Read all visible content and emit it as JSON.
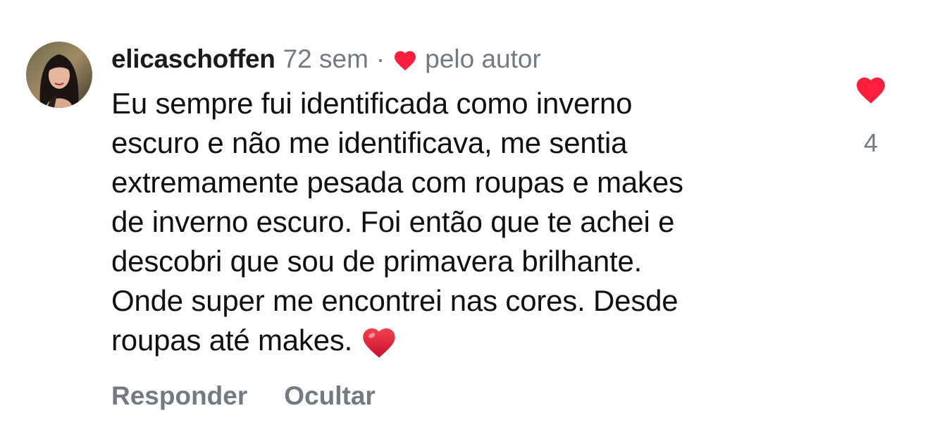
{
  "comment": {
    "username": "elicaschoffen",
    "time_ago": "72 sem",
    "separator": "·",
    "liked_by_author_label": "pelo autor",
    "text": "Eu sempre fui identificada como inverno\nescuro e não me identificava, me sentia\nextremamente pesada com roupas e makes\nde inverno escuro. Foi então que te achei e\ndescobri que sou de primavera brilhante.\nOnde super me encontrei nas cores. Desde\nroupas até makes.",
    "trailing_emoji": "red-heart-emoji",
    "like_count": "4",
    "liked": true
  },
  "actions": {
    "reply_label": "Responder",
    "hide_label": "Ocultar"
  },
  "icons": {
    "author_heart": "heart-icon",
    "like": "heart-icon"
  },
  "colors": {
    "like_red": "#ff1f3d",
    "secondary_text": "#737a82",
    "primary_text": "#111111"
  }
}
